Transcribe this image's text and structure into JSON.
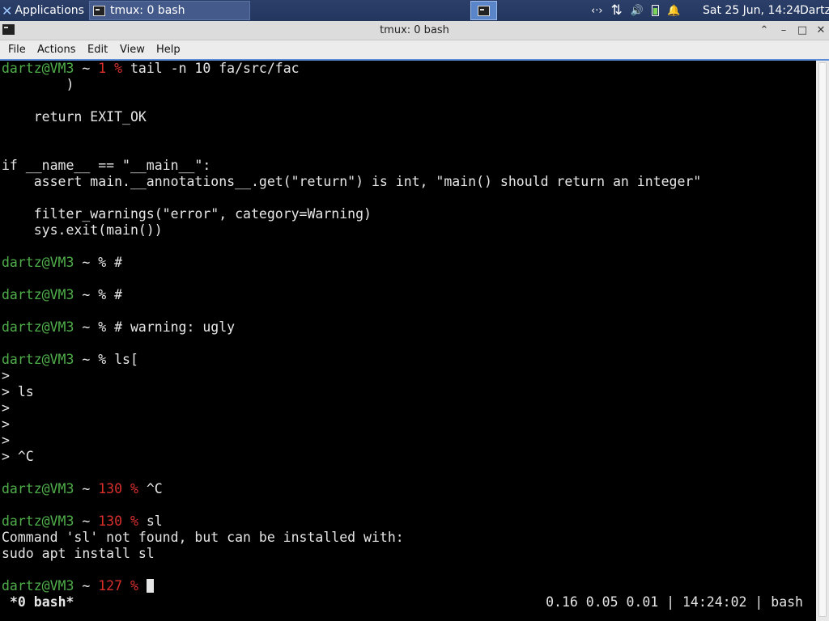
{
  "panel": {
    "applications_label": "Applications",
    "task_title": "tmux: 0 bash",
    "clock": "Sat 25 Jun, 14:24",
    "user": "Dartz",
    "network_glyph": "‹·›",
    "transfer_glyph": "⇅",
    "volume_glyph": "🔊",
    "bell_glyph": "🔔"
  },
  "window": {
    "title": "tmux: 0 bash",
    "up_glyph": "⌃",
    "min_glyph": "–",
    "max_glyph": "□",
    "close_glyph": "✕"
  },
  "menu": {
    "file": "File",
    "actions": "Actions",
    "edit": "Edit",
    "view": "View",
    "help": "Help"
  },
  "terminal": {
    "prompt_user": "dartz@VM3",
    "prompt_dir": " ~ ",
    "pct": "%",
    "lines": {
      "l0_code": "1 %",
      "l0_cmd": " tail -n 10 fa/src/fac",
      "l1": "        )",
      "l3": "    return EXIT_OK",
      "l6": "if __name__ == \"__main__\":",
      "l7": "    assert main.__annotations__.get(\"return\") is int, \"main() should return an integer\"",
      "l9": "    filter_warnings(\"error\", category=Warning)",
      "l10": "    sys.exit(main())",
      "l12_cmd": " #",
      "l14_cmd": " #",
      "l16_cmd": " # warning: ugly",
      "l18_cmd": " ls[",
      "l19": ">",
      "l20": "> ls",
      "l21": ">",
      "l22": ">",
      "l23": ">",
      "l24": "> ^C",
      "l26_code": "130 %",
      "l26_cmd": " ^C",
      "l28_code": "130 %",
      "l28_cmd": " sl",
      "l29": "Command 'sl' not found, but can be installed with:",
      "l30": "sudo apt install sl",
      "l32_code": "127 %"
    }
  },
  "status": {
    "left": "*0 bash*",
    "right": "0.16 0.05 0.01 | 14:24:02 | bash"
  }
}
